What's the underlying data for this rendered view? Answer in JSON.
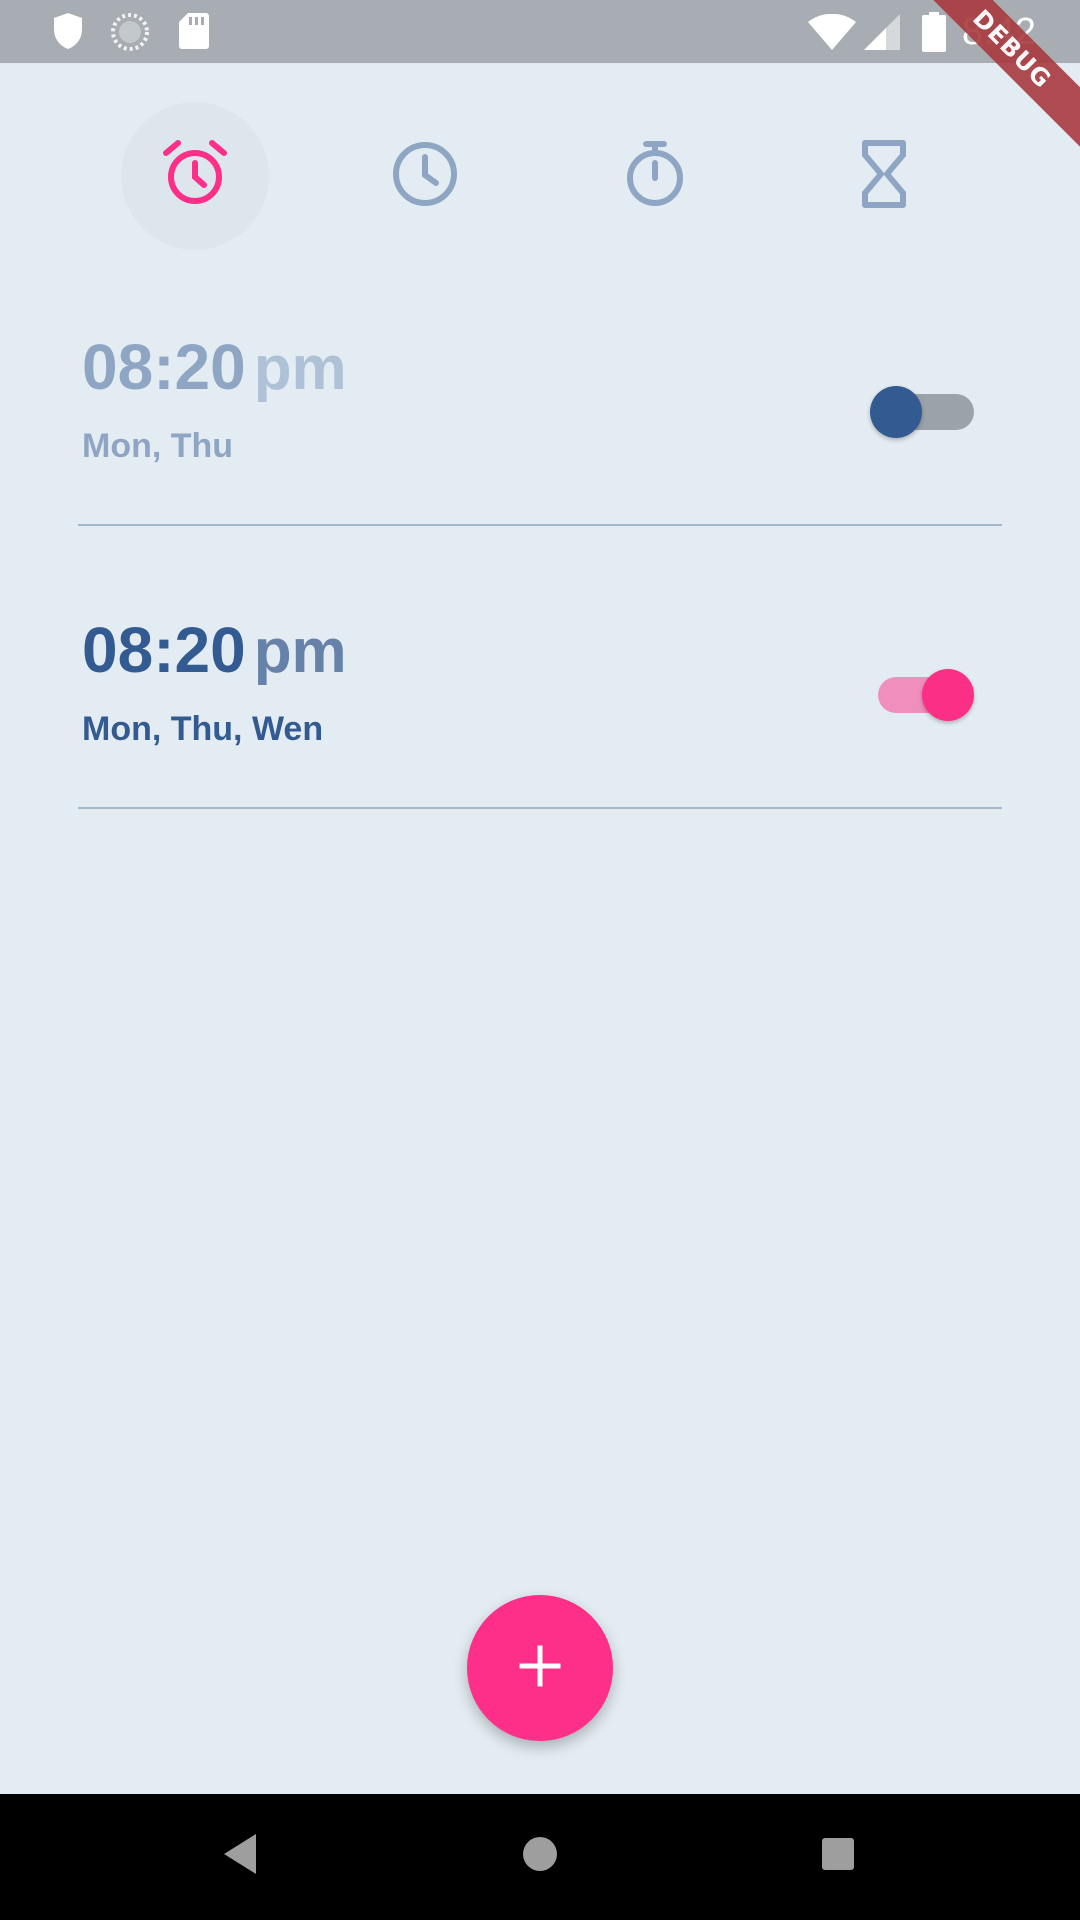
{
  "status_bar": {
    "time": "8:42",
    "left_icons": [
      "shield-icon",
      "sync-icon",
      "sd-card-icon"
    ],
    "right_icons": [
      "wifi-icon",
      "cellular-signal-icon",
      "battery-icon"
    ]
  },
  "debug_banner": "DEBUG",
  "tabs": [
    {
      "name": "alarm",
      "icon": "alarm-icon",
      "active": true
    },
    {
      "name": "clock",
      "icon": "clock-icon",
      "active": false
    },
    {
      "name": "stopwatch",
      "icon": "stopwatch-icon",
      "active": false
    },
    {
      "name": "timer",
      "icon": "hourglass-icon",
      "active": false
    }
  ],
  "alarms": [
    {
      "time": "08:20",
      "period": "pm",
      "days": "Mon, Thu",
      "enabled": false
    },
    {
      "time": "08:20",
      "period": "pm",
      "days": "Mon, Thu, Wen",
      "enabled": true
    }
  ],
  "fab": {
    "icon": "plus-icon"
  },
  "nav_bar": [
    "back-icon",
    "home-icon",
    "recents-icon"
  ],
  "colors": {
    "accent": "#fd2f88",
    "primary": "#335b91",
    "background": "#e3ecf2",
    "icon_inactive": "#8ea6c3"
  }
}
